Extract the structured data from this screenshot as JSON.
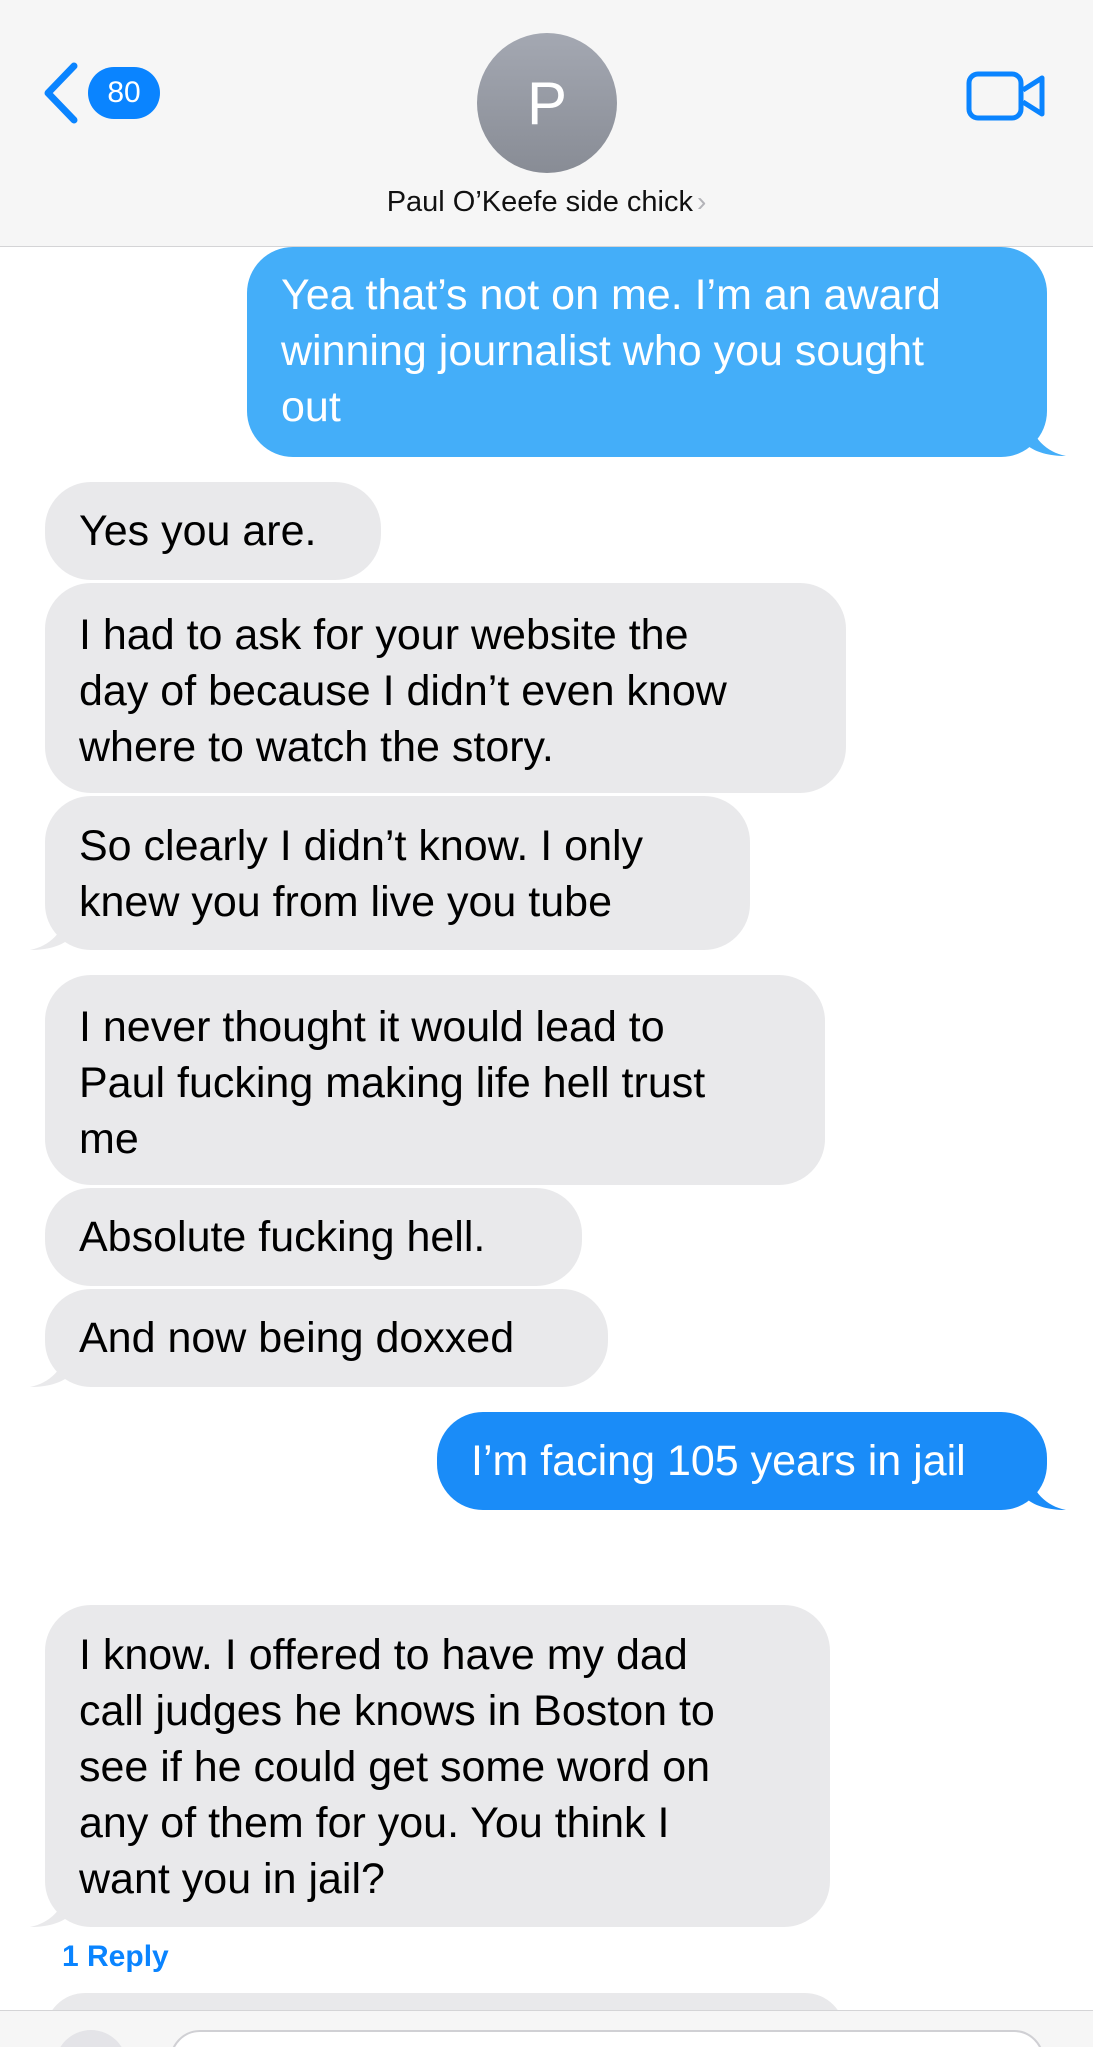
{
  "header": {
    "back_count": "80",
    "avatar_initial": "P",
    "contact_name": "Paul O’Keefe side chick",
    "chevron": "›"
  },
  "messages": [
    {
      "direction": "outgoing",
      "text": "Yea that’s not on me. I’m an award\nwinning journalist who you sought\nout"
    },
    {
      "direction": "incoming",
      "text": "Yes you are."
    },
    {
      "direction": "incoming",
      "text": "I had to ask for your website the\nday of because I didn’t even know\nwhere to watch the story."
    },
    {
      "direction": "incoming",
      "text": "So clearly I didn’t know. I only\nknew you from live you tube"
    },
    {
      "direction": "incoming",
      "text": "I never thought it would lead to\nPaul fucking making life hell trust\nme"
    },
    {
      "direction": "incoming",
      "text": "Absolute fucking hell."
    },
    {
      "direction": "incoming",
      "text": "And now being doxxed"
    },
    {
      "direction": "outgoing",
      "text": "I’m facing 105 years in jail"
    },
    {
      "direction": "incoming",
      "text": "I know. I offered to have my dad\ncall judges he knows in Boston to\nsee if he could get some word on\nany of them for you. You think I\nwant you in jail?"
    }
  ],
  "reply_link": "1 Reply",
  "colors": {
    "accent": "#0a84ff",
    "outgoing_bubble": "#44aef9",
    "outgoing_bubble_dark": "#1a8cf8",
    "incoming_bubble": "#e9e9eb"
  },
  "icons": [
    "chevron-left-icon",
    "video-camera-icon"
  ]
}
